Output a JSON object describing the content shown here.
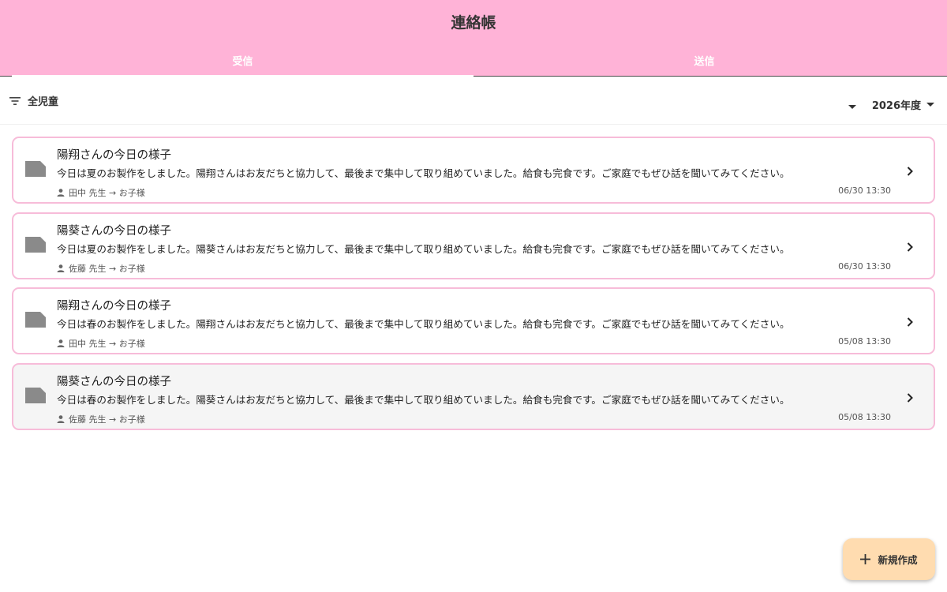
{
  "header": {
    "title": "連絡帳",
    "tabs": [
      {
        "label": "受信",
        "active": true
      },
      {
        "label": "送信",
        "active": false
      }
    ]
  },
  "filter": {
    "children_label": "全児童",
    "year_label": "2026年度"
  },
  "messages": [
    {
      "title": "陽翔さんの今日の様子",
      "body": "今日は夏のお製作をしました。陽翔さんはお友だちと協力して、最後まで集中して取り組めていました。給食も完食です。ご家庭でもぜひ話を聞いてみてください。",
      "sender": "田中 先生 → お子様",
      "time": "06/30 13:30",
      "selected": false
    },
    {
      "title": "陽葵さんの今日の様子",
      "body": "今日は夏のお製作をしました。陽葵さんはお友だちと協力して、最後まで集中して取り組めていました。給食も完食です。ご家庭でもぜひ話を聞いてみてください。",
      "sender": "佐藤 先生 → お子様",
      "time": "06/30 13:30",
      "selected": false
    },
    {
      "title": "陽翔さんの今日の様子",
      "body": "今日は春のお製作をしました。陽翔さんはお友だちと協力して、最後まで集中して取り組めていました。給食も完食です。ご家庭でもぜひ話を聞いてみてください。",
      "sender": "田中 先生 → お子様",
      "time": "05/08 13:30",
      "selected": false
    },
    {
      "title": "陽葵さんの今日の様子",
      "body": "今日は春のお製作をしました。陽葵さんはお友だちと協力して、最後まで集中して取り組めていました。給食も完食です。ご家庭でもぜひ話を聞いてみてください。",
      "sender": "佐藤 先生 → お子様",
      "time": "05/08 13:30",
      "selected": true
    }
  ],
  "fab": {
    "label": "新規作成"
  },
  "colors": {
    "header_bg": "#ffb3d7",
    "card_border": "#f7bcd9",
    "fab_bg": "#ffdcb0",
    "selected_bg": "#f5f5f5"
  },
  "icons": {
    "filter": "filter-list-icon",
    "caret": "arrow-drop-down-icon",
    "message": "folded-document-icon",
    "sender": "person-icon",
    "open": "chevron-right-icon",
    "fab": "plus-icon"
  }
}
